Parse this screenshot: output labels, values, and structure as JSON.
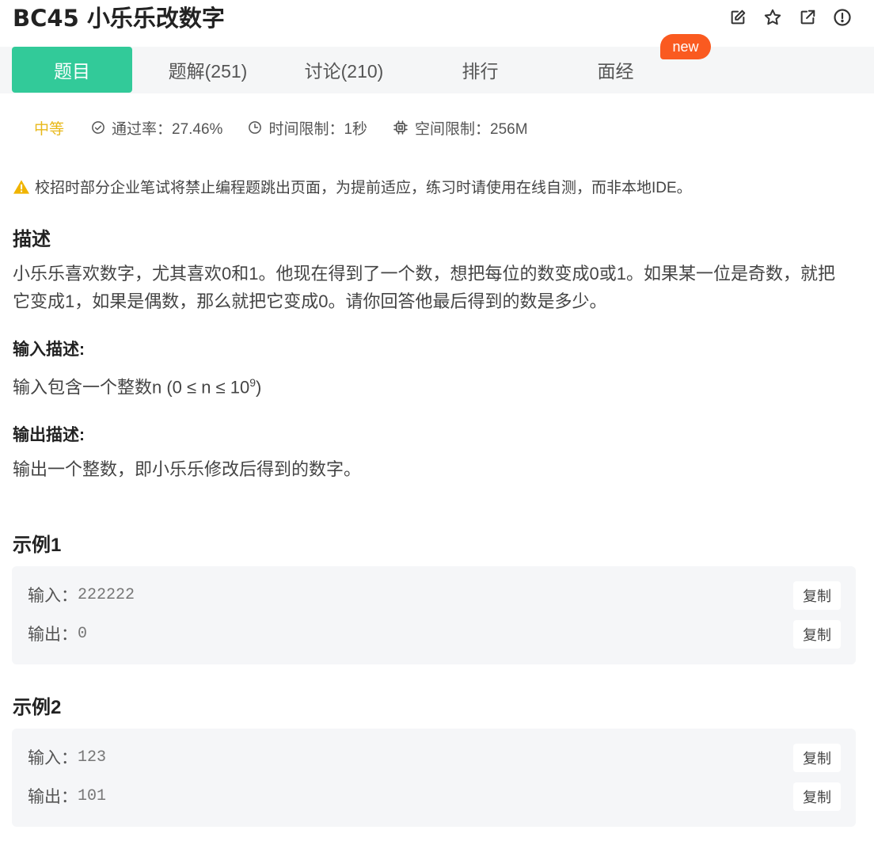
{
  "header": {
    "title": "BC45  小乐乐改数字",
    "actions": [
      {
        "name": "edit-note-icon"
      },
      {
        "name": "star-icon"
      },
      {
        "name": "external-link-icon"
      },
      {
        "name": "alert-circle-icon"
      }
    ]
  },
  "tabs": [
    {
      "label": "题目"
    },
    {
      "label": "题解(251)"
    },
    {
      "label": "讨论(210)"
    },
    {
      "label": "排行"
    },
    {
      "label": "面经"
    }
  ],
  "badge": {
    "new": "new"
  },
  "meta": {
    "difficulty": "中等",
    "pass_rate": "通过率：27.46%",
    "time_limit": "时间限制：1秒",
    "space_limit": "空间限制：256M"
  },
  "notice": "校招时部分企业笔试将禁止编程题跳出页面，为提前适应，练习时请使用在线自测，而非本地IDE。",
  "description": {
    "heading": "描述",
    "text": "小乐乐喜欢数字，尤其喜欢0和1。他现在得到了一个数，想把每位的数变成0或1。如果某一位是奇数，就把它变成1，如果是偶数，那么就把它变成0。请你回答他最后得到的数是多少。"
  },
  "input_desc": {
    "heading": "输入描述:",
    "text_before": "输入包含一个整数n (0 ≤ n ≤ 10",
    "sup": "9",
    "text_after": ")"
  },
  "output_desc": {
    "heading": "输出描述:",
    "text": "输出一个整数，即小乐乐修改后得到的数字。"
  },
  "examples": [
    {
      "heading": "示例1",
      "input_label": "输入：",
      "input_value": "222222",
      "output_label": "输出：",
      "output_value": "0",
      "copy_label": "复制"
    },
    {
      "heading": "示例2",
      "input_label": "输入：",
      "input_value": "123",
      "output_label": "输出：",
      "output_value": "101",
      "copy_label": "复制"
    }
  ],
  "colors": {
    "accent": "#32ca99",
    "badge": "#fa5a20",
    "difficulty": "#e8b81a",
    "warning": "#f0b400"
  }
}
